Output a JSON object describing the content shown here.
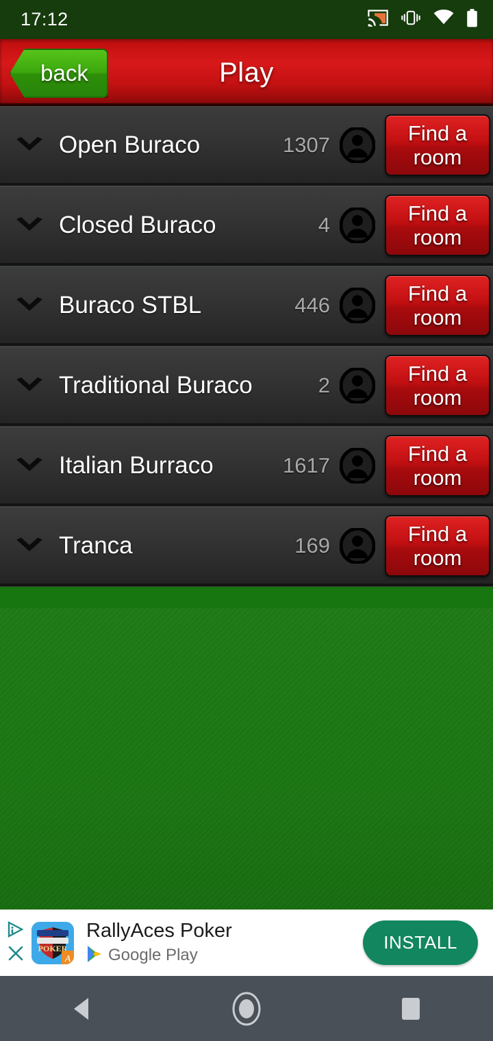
{
  "status_bar": {
    "time": "17:12",
    "icons": [
      "cast-icon",
      "vibrate-icon",
      "wifi-icon",
      "battery-icon"
    ]
  },
  "header": {
    "title": "Play",
    "back_label": "back"
  },
  "list": {
    "rows": [
      {
        "name": "Open Buraco",
        "count": "1307",
        "action_line1": "Find a",
        "action_line2": "room"
      },
      {
        "name": "Closed Buraco",
        "count": "4",
        "action_line1": "Find a",
        "action_line2": "room"
      },
      {
        "name": "Buraco STBL",
        "count": "446",
        "action_line1": "Find a",
        "action_line2": "room"
      },
      {
        "name": "Traditional Buraco",
        "count": "2",
        "action_line1": "Find a",
        "action_line2": "room"
      },
      {
        "name": "Italian Burraco",
        "count": "1617",
        "action_line1": "Find a",
        "action_line2": "room"
      },
      {
        "name": "Tranca",
        "count": "169",
        "action_line1": "Find a",
        "action_line2": "room"
      }
    ]
  },
  "ad": {
    "title": "RallyAces Poker",
    "store": "Google Play",
    "install_label": "INSTALL",
    "icon_text_top": "TEXAS HOLD'EM",
    "icon_text_main": "POKER",
    "icon_badge": "A",
    "adchoices_icon": "adchoices-icon",
    "close_icon": "close-icon"
  },
  "navbar": {
    "back_icon": "nav-back-icon",
    "home_icon": "nav-home-icon",
    "recents_icon": "nav-recents-icon"
  },
  "colors": {
    "header_red": "#c41112",
    "back_green": "#3ba70d",
    "felt_green": "#1c7a13",
    "button_red": "#c10f12",
    "install_green": "#12865f",
    "count_gray": "#a9a9a9"
  }
}
